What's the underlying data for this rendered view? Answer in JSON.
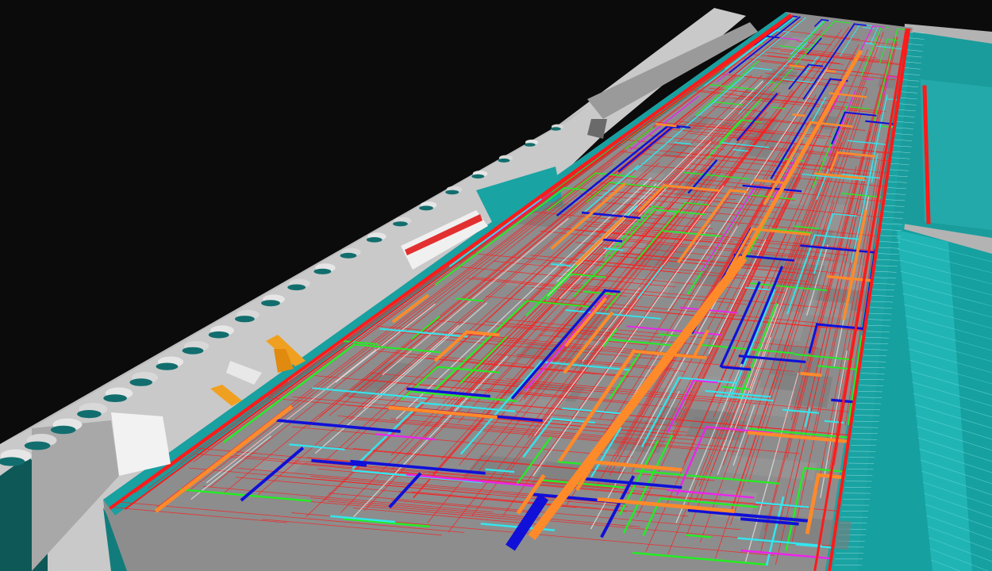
{
  "scene": {
    "kind": "bim-mep-3d-model-view",
    "background_color": "#0b0b0b",
    "colors": {
      "ground": "#c8c8c8",
      "ground_dark": "#9c9c9c",
      "roof_slab": "#8f8f8f",
      "wall": "#a9a9a9",
      "teal_panel": "#1aa3a3",
      "teal_dark": "#0e7676",
      "fire_pipe": "#ff1a1a",
      "hvac_duct_orange": "#ff8a2a",
      "chilled_water_blue": "#1010d8",
      "cyan_pipe": "#33e6ee",
      "green_pipe": "#22ee22",
      "magenta_pipe": "#ee22ee",
      "white_cable_tray": "#f4f4f4",
      "crane_orange": "#f0a020"
    },
    "pipe_systems": [
      {
        "name": "fire-sprinkler",
        "color_key": "fire_pipe"
      },
      {
        "name": "hvac-duct",
        "color_key": "hvac_duct_orange"
      },
      {
        "name": "chilled-water",
        "color_key": "chilled_water_blue"
      },
      {
        "name": "domestic-water",
        "color_key": "cyan_pipe"
      },
      {
        "name": "drainage",
        "color_key": "green_pipe"
      },
      {
        "name": "gas",
        "color_key": "magenta_pipe"
      },
      {
        "name": "cable-tray",
        "color_key": "white_cable_tray"
      }
    ],
    "objects": [
      {
        "name": "ground-plane-icon",
        "type": "surface"
      },
      {
        "name": "building-roof-icon",
        "type": "structure"
      },
      {
        "name": "mep-grid-icon",
        "type": "systems"
      },
      {
        "name": "tower-crane-icon",
        "type": "equipment"
      },
      {
        "name": "site-trees-icon",
        "type": "landscape"
      },
      {
        "name": "east-curtain-wall-icon",
        "type": "facade"
      }
    ]
  }
}
